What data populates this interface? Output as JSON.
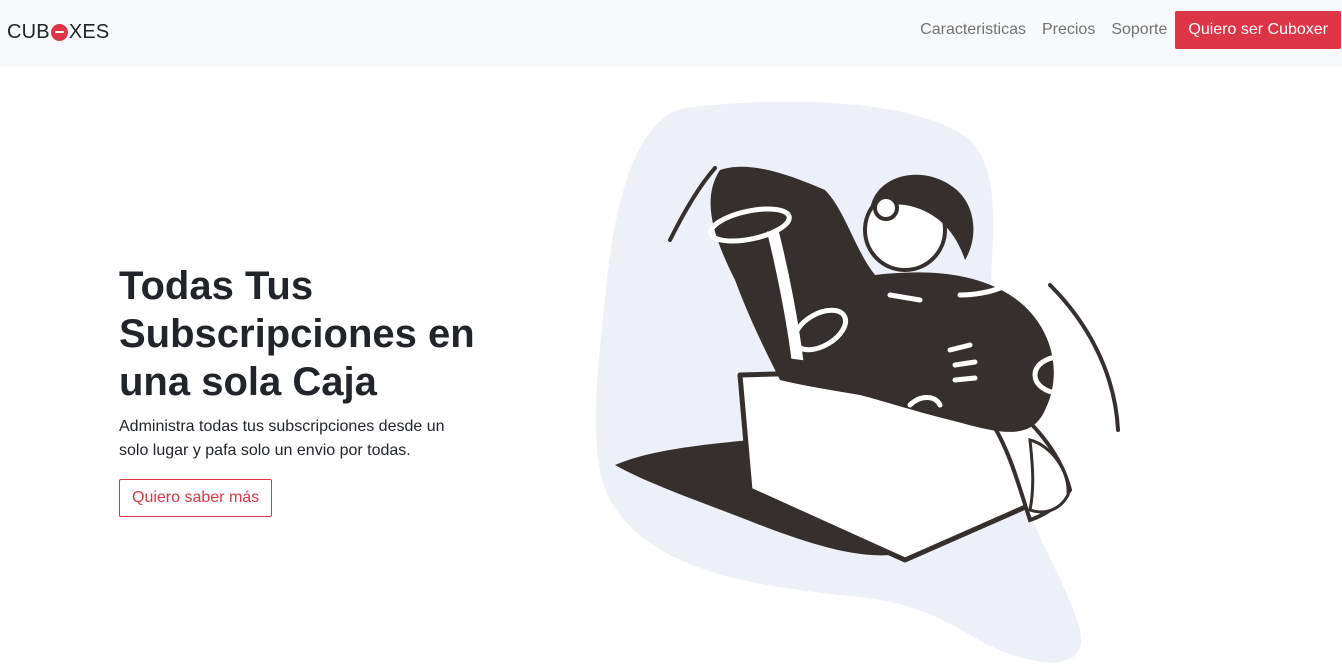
{
  "nav": {
    "brand_prefix": "CUB",
    "brand_suffix": "XES",
    "links": [
      "Caracteristicas",
      "Precios",
      "Soporte"
    ],
    "cta_label": "Quiero ser Cuboxer"
  },
  "hero": {
    "title": "Todas Tus Subscripciones en una sola Caja",
    "subtitle": "Administra todas tus subscripciones desde un solo lugar y pafa solo un envio por todas.",
    "button_label": "Quiero saber más"
  },
  "colors": {
    "accent": "#dc3545",
    "navbar_bg": "#f8f9fa",
    "illustration_ink": "#35302d",
    "illustration_blob": "#edf0f7"
  },
  "icons": {
    "brand_o": "brand-cube-icon",
    "illustration": "person-jumping-out-of-box-illustration"
  }
}
